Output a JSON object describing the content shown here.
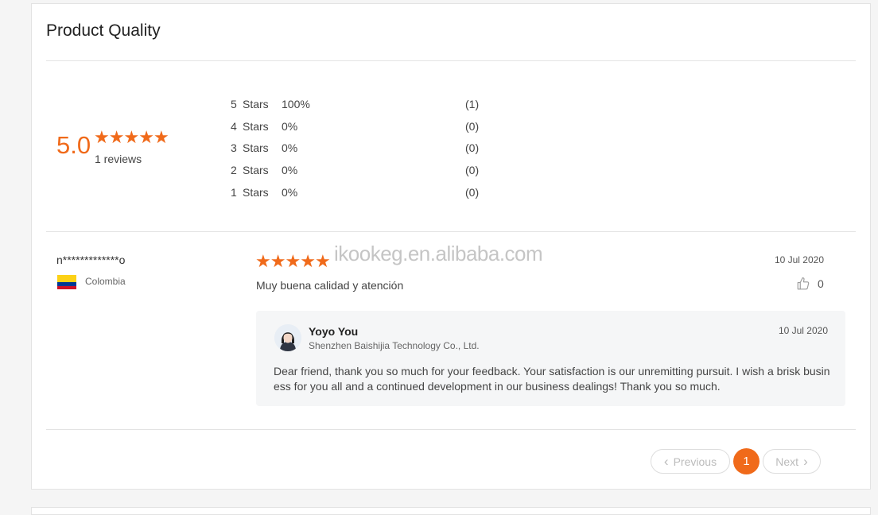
{
  "section": {
    "title": "Product Quality"
  },
  "summary": {
    "score": "5.0",
    "reviews": "1 reviews",
    "distribution": [
      {
        "stars": "5",
        "label": "Stars",
        "percent": "100%",
        "count": "(1)"
      },
      {
        "stars": "4",
        "label": "Stars",
        "percent": "0%",
        "count": "(0)"
      },
      {
        "stars": "3",
        "label": "Stars",
        "percent": "0%",
        "count": "(0)"
      },
      {
        "stars": "2",
        "label": "Stars",
        "percent": "0%",
        "count": "(0)"
      },
      {
        "stars": "1",
        "label": "Stars",
        "percent": "0%",
        "count": "(0)"
      }
    ]
  },
  "review": {
    "reviewer": "n*************o",
    "country": "Colombia",
    "rating": 5,
    "date": "10 Jul 2020",
    "text": "Muy buena calidad y atención",
    "likes": "0",
    "reply": {
      "name": "Yoyo You",
      "company": "Shenzhen Baishijia Technology Co., Ltd.",
      "date": "10 Jul 2020",
      "text": "Dear friend, thank you so much for your feedback. Your satisfaction is our unremitting pursuit. I wish a brisk business for you all and a continued development in our business dealings! Thank you so much."
    }
  },
  "pagination": {
    "previous": "Previous",
    "current": "1",
    "next": "Next"
  },
  "watermark": "ikookeg.en.alibaba.com",
  "colors": {
    "accent": "#f06a1a",
    "flag_yellow": "#fcd116",
    "flag_blue": "#003893",
    "flag_red": "#ce1126"
  }
}
